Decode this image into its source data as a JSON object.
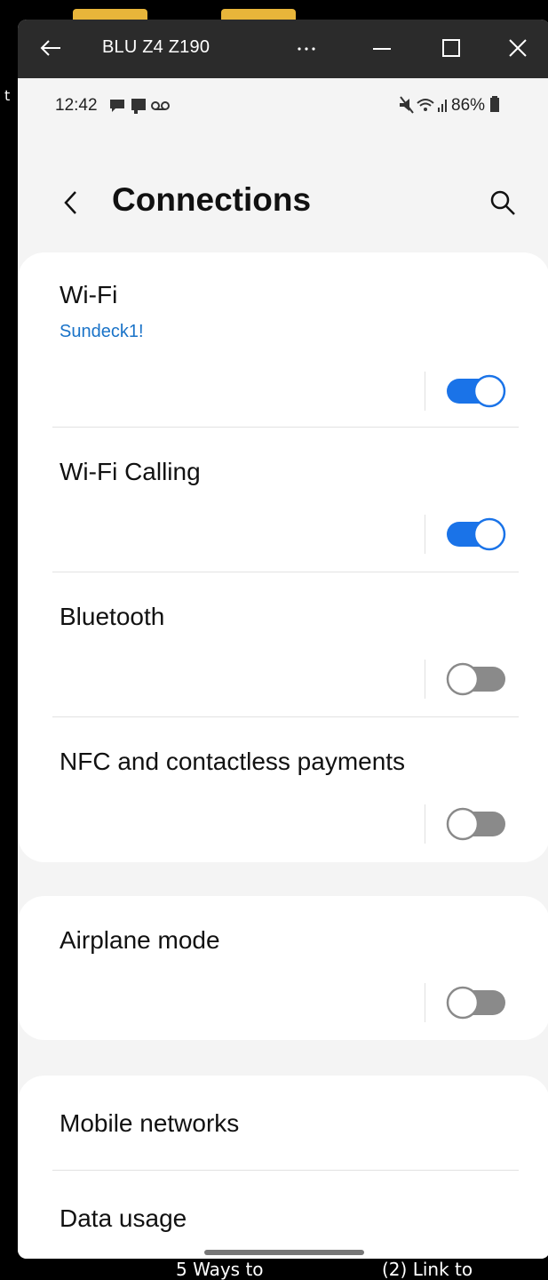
{
  "window": {
    "title": "BLU Z4 Z190",
    "controls": {
      "back_icon": "arrow-left-icon",
      "more_icon": "ellipsis-icon",
      "minimize_icon": "minimize-icon",
      "maximize_icon": "maximize-icon",
      "close_icon": "close-icon"
    }
  },
  "desktop": {
    "edge_char": "t",
    "taskbar": [
      "5 Ways to",
      "(2) Link to"
    ]
  },
  "status_bar": {
    "time": "12:42",
    "battery": "86%"
  },
  "header": {
    "title": "Connections"
  },
  "settings": {
    "wifi": {
      "label": "Wi-Fi",
      "network": "Sundeck1!",
      "enabled": true
    },
    "wifi_calling": {
      "label": "Wi-Fi Calling",
      "enabled": true
    },
    "bluetooth": {
      "label": "Bluetooth",
      "enabled": false
    },
    "nfc": {
      "label": "NFC and contactless payments",
      "enabled": false
    },
    "airplane": {
      "label": "Airplane mode",
      "enabled": false
    },
    "mobile_networks": {
      "label": "Mobile networks"
    },
    "data_usage": {
      "label": "Data usage"
    }
  },
  "colors": {
    "accent": "#1a73e8",
    "toggle_off": "#8a8a8a",
    "subtitle": "#1a73c8"
  }
}
